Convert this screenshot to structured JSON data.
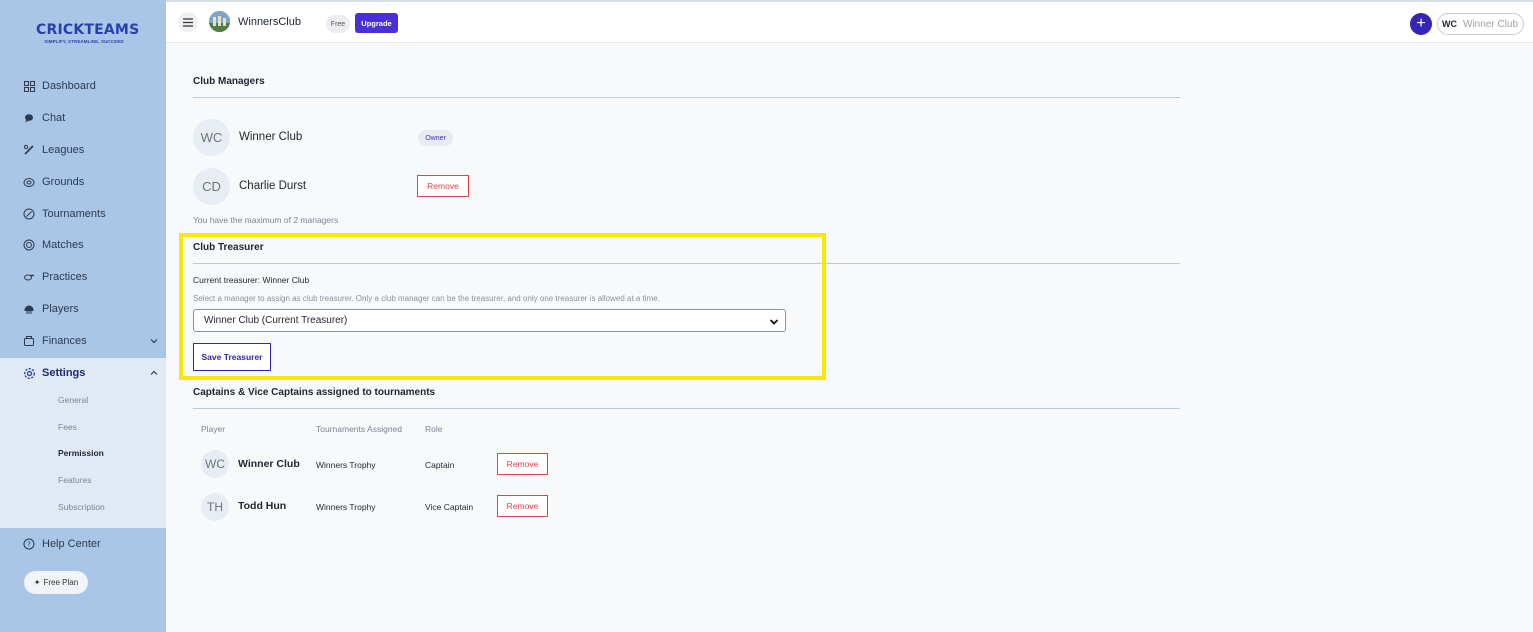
{
  "brand": {
    "name": "CRICKTEAMS",
    "tagline": "SIMPLIFY, STREAMLINE, SUCCEED"
  },
  "sidebar": {
    "items": [
      {
        "label": "Dashboard",
        "icon": "grid-icon"
      },
      {
        "label": "Chat",
        "icon": "chat-bubble-icon"
      },
      {
        "label": "Leagues",
        "icon": "cricket-bat-icon"
      },
      {
        "label": "Grounds",
        "icon": "stadium-icon"
      },
      {
        "label": "Tournaments",
        "icon": "trophy-icon"
      },
      {
        "label": "Matches",
        "icon": "ball-icon"
      },
      {
        "label": "Practices",
        "icon": "whistle-icon"
      },
      {
        "label": "Players",
        "icon": "helmet-icon"
      },
      {
        "label": "Finances",
        "icon": "wallet-icon"
      },
      {
        "label": "Settings",
        "icon": "gear-icon"
      }
    ],
    "settings_sub": [
      "General",
      "Fees",
      "Permission",
      "Features",
      "Subscription"
    ],
    "help": "Help Center",
    "plan": "Free Plan"
  },
  "header": {
    "club_name": "WinnersClub",
    "free_badge": "Free",
    "upgrade": "Upgrade",
    "plus": "+",
    "user_initials": "WC",
    "user_name": "Winner Club"
  },
  "managers": {
    "title": "Club Managers",
    "list": [
      {
        "initials": "WC",
        "name": "Winner Club",
        "badge": "Owner"
      },
      {
        "initials": "CD",
        "name": "Charlie Durst",
        "action": "Remove"
      }
    ],
    "note": "You have the maximum of 2 managers"
  },
  "treasurer": {
    "title": "Club Treasurer",
    "current": "Current treasurer: Winner Club",
    "help": "Select a manager to assign as club treasurer. Only a club manager can be the treasurer, and only one treasurer is allowed at a time.",
    "selected": "Winner Club (Current Treasurer)",
    "save": "Save Treasurer"
  },
  "captains": {
    "title": "Captains & Vice Captains assigned to tournaments",
    "headers": [
      "Player",
      "Tournaments Assigned",
      "Role"
    ],
    "rows": [
      {
        "initials": "WC",
        "name": "Winner Club",
        "tournament": "Winners Trophy",
        "role": "Captain",
        "action": "Remove"
      },
      {
        "initials": "TH",
        "name": "Todd Hun",
        "tournament": "Winners Trophy",
        "role": "Vice Captain",
        "action": "Remove"
      }
    ]
  },
  "colors": {
    "accent": "#3424b8",
    "sidebar": "#a9c6e6",
    "danger": "#e0424b",
    "highlight": "#f5ea00"
  }
}
